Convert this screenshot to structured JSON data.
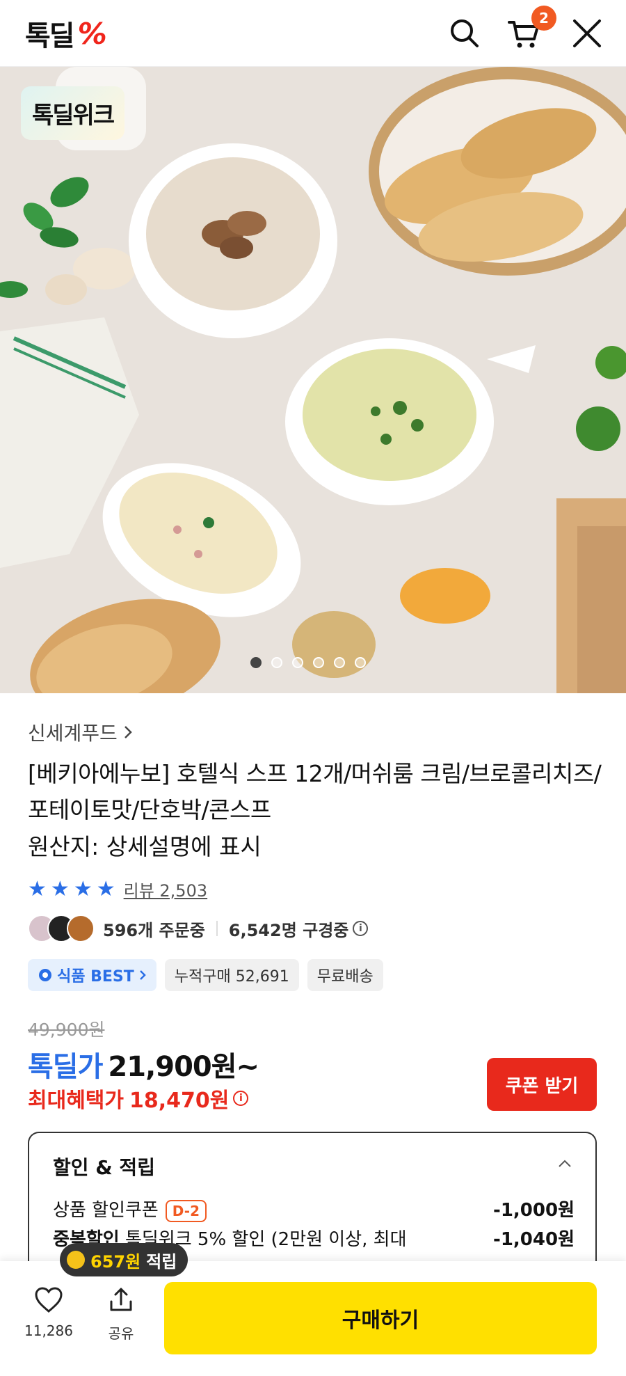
{
  "header": {
    "logo": "톡딜",
    "logo_mark": "%",
    "cart_count": "2"
  },
  "hero": {
    "badge": "톡딜위크",
    "carousel_total": 6,
    "carousel_active": 1
  },
  "product": {
    "brand": "신세계푸드",
    "title": "[베키아에누보] 호텔식 스프 12개/머쉬룸 크림/브로콜리치즈/포테이토맛/단호박/콘스프",
    "origin": "원산지: 상세설명에 표시",
    "rating_stars": 4,
    "review_label": "리뷰 2,503",
    "orders": "596개 주문중",
    "viewers": "6,542명 구경중",
    "tags": {
      "best": "식품 BEST",
      "cumulative": "누적구매 52,691",
      "shipping": "무료배송"
    },
    "original_price": "49,900원",
    "deal_label": "톡딜가",
    "deal_price": "21,900원~",
    "max_label": "최대혜택가",
    "max_price": "18,470원",
    "coupon_button": "쿠폰 받기"
  },
  "discount": {
    "title": "할인 & 적립",
    "rows": [
      {
        "label": "상품 할인쿠폰",
        "badge": "D-2",
        "amount": "-1,000원"
      },
      {
        "label_bold": "중복할인",
        "label": " 톡딜위크 5% 할인 (2만원 이상, 최대",
        "amount": "-1,040원"
      }
    ]
  },
  "points": {
    "amount": "657원",
    "label": "적립"
  },
  "bottom": {
    "likes": "11,286",
    "share": "공유",
    "buy": "구매하기"
  },
  "colors": {
    "brand_red": "#f0251c",
    "deal_blue": "#2a6ee6",
    "buy_yellow": "#ffe000",
    "badge_orange": "#f15a22"
  }
}
